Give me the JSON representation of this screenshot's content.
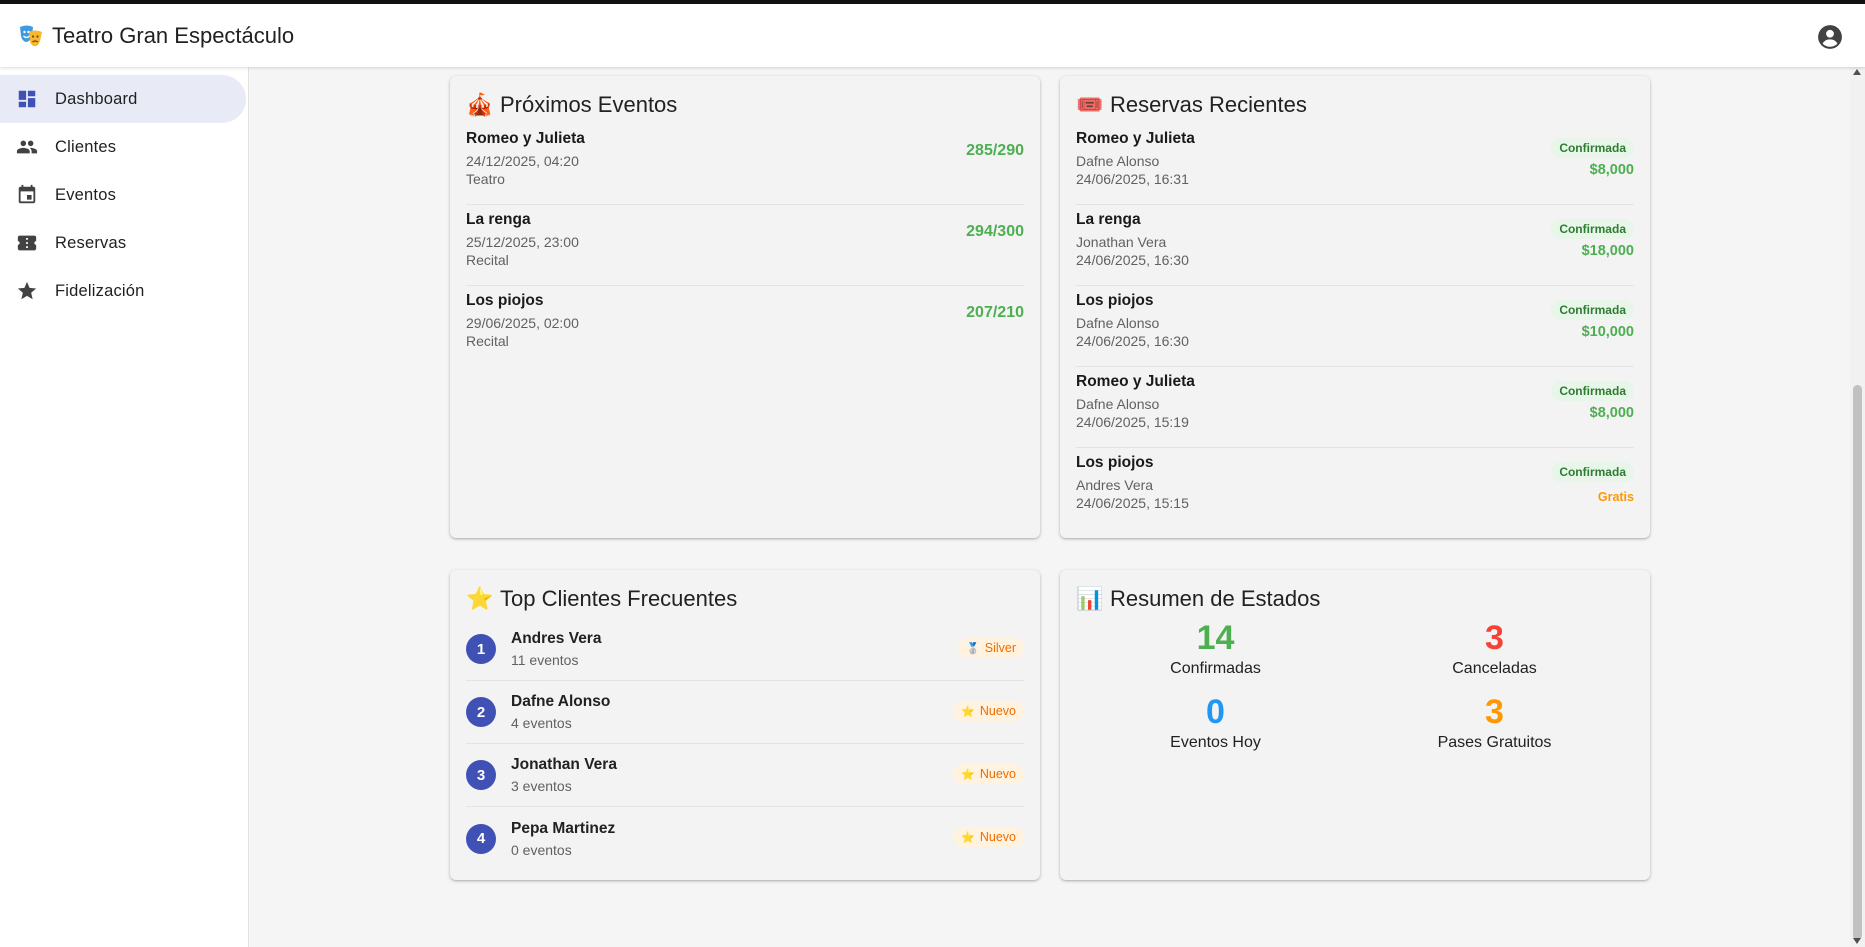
{
  "app": {
    "title": "Teatro Gran Espectáculo"
  },
  "colors": {
    "primary": "#3f51b5",
    "green": "#4caf50",
    "red": "#f44336",
    "blue": "#2196f3",
    "orange": "#ff9800"
  },
  "sidebar": {
    "items": [
      {
        "label": "Dashboard",
        "icon": "dashboard-icon",
        "active": true
      },
      {
        "label": "Clientes",
        "icon": "people-icon"
      },
      {
        "label": "Eventos",
        "icon": "calendar-icon"
      },
      {
        "label": "Reservas",
        "icon": "ticket-icon"
      },
      {
        "label": "Fidelización",
        "icon": "star-icon"
      }
    ]
  },
  "proximos": {
    "title": "Próximos Eventos",
    "icon": "circus-tent-icon",
    "items": [
      {
        "name": "Romeo y Julieta",
        "date": "24/12/2025, 04:20",
        "type": "Teatro",
        "capacity": "285/290"
      },
      {
        "name": "La renga",
        "date": "25/12/2025, 23:00",
        "type": "Recital",
        "capacity": "294/300"
      },
      {
        "name": "Los piojos",
        "date": "29/06/2025, 02:00",
        "type": "Recital",
        "capacity": "207/210"
      }
    ]
  },
  "reservas": {
    "title": "Reservas Recientes",
    "icon": "ticket-icon",
    "items": [
      {
        "event": "Romeo y Julieta",
        "client": "Dafne Alonso",
        "date": "24/06/2025, 16:31",
        "status": "Confirmada",
        "amount": "$8,000"
      },
      {
        "event": "La renga",
        "client": "Jonathan Vera",
        "date": "24/06/2025, 16:30",
        "status": "Confirmada",
        "amount": "$18,000"
      },
      {
        "event": "Los piojos",
        "client": "Dafne Alonso",
        "date": "24/06/2025, 16:30",
        "status": "Confirmada",
        "amount": "$10,000"
      },
      {
        "event": "Romeo y Julieta",
        "client": "Dafne Alonso",
        "date": "24/06/2025, 15:19",
        "status": "Confirmada",
        "amount": "$8,000"
      },
      {
        "event": "Los piojos",
        "client": "Andres Vera",
        "date": "24/06/2025, 15:15",
        "status": "Confirmada",
        "amount": "Gratis"
      }
    ]
  },
  "top_clientes": {
    "title": "Top Clientes Frecuentes",
    "icon": "star-icon",
    "items": [
      {
        "rank": "1",
        "name": "Andres Vera",
        "count": "11 eventos",
        "tier": "Silver",
        "tier_icon": "medal-icon"
      },
      {
        "rank": "2",
        "name": "Dafne Alonso",
        "count": "4 eventos",
        "tier": "Nuevo",
        "tier_icon": "star-icon"
      },
      {
        "rank": "3",
        "name": "Jonathan Vera",
        "count": "3 eventos",
        "tier": "Nuevo",
        "tier_icon": "star-icon"
      },
      {
        "rank": "4",
        "name": "Pepa Martinez",
        "count": "0 eventos",
        "tier": "Nuevo",
        "tier_icon": "star-icon"
      }
    ]
  },
  "resumen": {
    "title": "Resumen de Estados",
    "icon": "bar-chart-icon",
    "stats": [
      {
        "value": "14",
        "label": "Confirmadas",
        "color": "#4caf50"
      },
      {
        "value": "3",
        "label": "Canceladas",
        "color": "#f44336"
      },
      {
        "value": "0",
        "label": "Eventos Hoy",
        "color": "#2196f3"
      },
      {
        "value": "3",
        "label": "Pases Gratuitos",
        "color": "#ff9800"
      }
    ]
  }
}
